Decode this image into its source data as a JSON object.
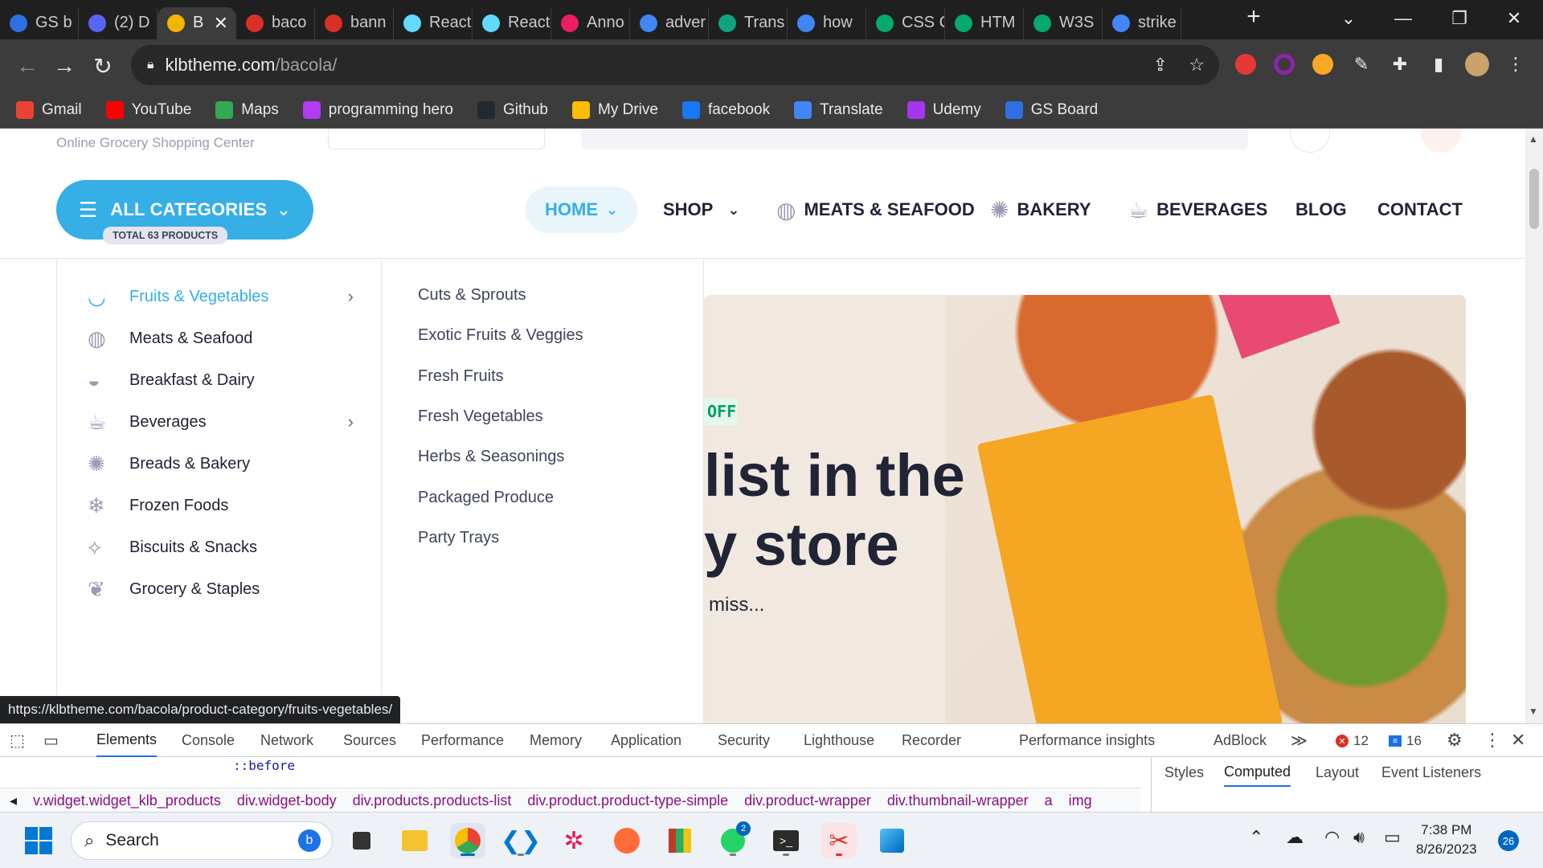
{
  "browser": {
    "tabs": [
      {
        "title": "GS b",
        "icon": "gs-board-icon",
        "color": "#2f6fe4"
      },
      {
        "title": "(2) D",
        "icon": "discord-icon",
        "color": "#5865f2"
      },
      {
        "title": "B",
        "icon": "bacola-icon",
        "color": "#f2b500",
        "active": true
      },
      {
        "title": "baco",
        "icon": "bacola-icon",
        "color": "#d93025"
      },
      {
        "title": "bann",
        "icon": "bacola-icon",
        "color": "#d93025"
      },
      {
        "title": "React",
        "icon": "react-icon",
        "color": "#61dafb"
      },
      {
        "title": "React",
        "icon": "react-icon",
        "color": "#61dafb"
      },
      {
        "title": "Anno",
        "icon": "annotation-icon",
        "color": "#e91e63"
      },
      {
        "title": "adver",
        "icon": "google-icon",
        "color": "#4285f4"
      },
      {
        "title": "Trans",
        "icon": "chatgpt-icon",
        "color": "#10a37f"
      },
      {
        "title": "how",
        "icon": "google-icon",
        "color": "#4285f4"
      },
      {
        "title": "CSS C",
        "icon": "w3schools-icon",
        "color": "#04aa6d"
      },
      {
        "title": "HTM",
        "icon": "w3schools-icon",
        "color": "#04aa6d"
      },
      {
        "title": "W3S",
        "icon": "w3schools-icon",
        "color": "#04aa6d"
      },
      {
        "title": "strike",
        "icon": "google-icon",
        "color": "#4285f4"
      }
    ],
    "url_host": "klbtheme.com",
    "url_path": "/bacola/",
    "bookmarks": [
      {
        "label": "Gmail",
        "icon": "gmail-icon",
        "color": "#ea4335"
      },
      {
        "label": "YouTube",
        "icon": "youtube-icon",
        "color": "#ff0000"
      },
      {
        "label": "Maps",
        "icon": "maps-icon",
        "color": "#34a853"
      },
      {
        "label": "programming hero",
        "icon": "programming-hero-icon",
        "color": "#b23cf2"
      },
      {
        "label": "Github",
        "icon": "github-icon",
        "color": "#24292e"
      },
      {
        "label": "My Drive",
        "icon": "drive-icon",
        "color": "#fbbc04"
      },
      {
        "label": "facebook",
        "icon": "facebook-icon",
        "color": "#1877f2"
      },
      {
        "label": "Translate",
        "icon": "translate-icon",
        "color": "#4285f4"
      },
      {
        "label": "Udemy",
        "icon": "udemy-icon",
        "color": "#a435f0"
      },
      {
        "label": "GS Board",
        "icon": "gs-board-icon",
        "color": "#2f6fe4"
      }
    ],
    "status_url": "https://klbtheme.com/bacola/product-category/fruits-vegetables/"
  },
  "site": {
    "tagline": "Online Grocery Shopping Center",
    "all_categories": "ALL CATEGORIES",
    "total_products": "TOTAL 63 PRODUCTS",
    "nav": {
      "home": "HOME",
      "shop": "SHOP",
      "meats": "MEATS & SEAFOOD",
      "bakery": "BAKERY",
      "beverages": "BEVERAGES",
      "blog": "BLOG",
      "contact": "CONTACT"
    },
    "categories": [
      {
        "label": "Fruits & Vegetables",
        "icon": "apple-icon",
        "arrow": true,
        "active": true
      },
      {
        "label": "Meats & Seafood",
        "icon": "steak-icon",
        "arrow": false
      },
      {
        "label": "Breakfast & Dairy",
        "icon": "egg-icon",
        "arrow": false
      },
      {
        "label": "Beverages",
        "icon": "cup-icon",
        "arrow": true
      },
      {
        "label": "Breads & Bakery",
        "icon": "bread-icon",
        "arrow": false
      },
      {
        "label": "Frozen Foods",
        "icon": "snowflake-icon",
        "arrow": false
      },
      {
        "label": "Biscuits & Snacks",
        "icon": "candy-icon",
        "arrow": false
      },
      {
        "label": "Grocery & Staples",
        "icon": "leaf-icon",
        "arrow": false
      }
    ],
    "subcategories": [
      "Cuts & Sprouts",
      "Exotic Fruits & Veggies",
      "Fresh Fruits",
      "Fresh Vegetables",
      "Herbs & Seasonings",
      "Packaged Produce",
      "Party Trays"
    ],
    "hero": {
      "badge": "OFF",
      "line1": "list in the",
      "line2": "y store",
      "sub": "miss..."
    },
    "accent": "#35afe6"
  },
  "devtools": {
    "tabs": [
      "Elements",
      "Console",
      "Network",
      "Sources",
      "Performance",
      "Memory",
      "Application",
      "Security",
      "Lighthouse",
      "Recorder",
      "Performance insights",
      "AdBlock"
    ],
    "errors": "12",
    "messages": "16",
    "code_line": "::before",
    "breadcrumbs": [
      "v.widget.widget_klb_products",
      "div.widget-body",
      "div.products.products-list",
      "div.product.product-type-simple",
      "div.product-wrapper",
      "div.thumbnail-wrapper",
      "a",
      "img"
    ],
    "side_tabs": [
      "Styles",
      "Computed",
      "Layout",
      "Event Listeners"
    ]
  },
  "taskbar": {
    "search": "Search",
    "time": "7:38 PM",
    "date": "8/26/2023",
    "notifications": "26",
    "whatsapp_badge": "2"
  }
}
